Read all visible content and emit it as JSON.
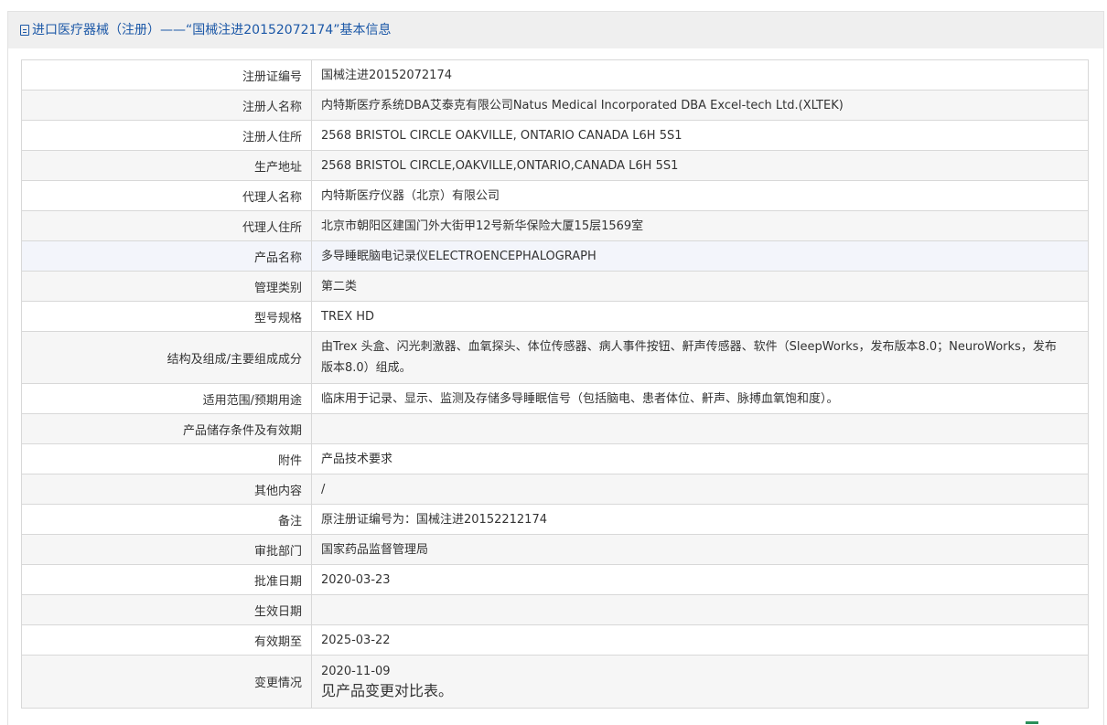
{
  "header": {
    "title": "进口医疗器械（注册）——“国械注进20152072174”基本信息",
    "icon": "document-icon"
  },
  "rows": [
    {
      "label": "注册证编号",
      "value": "国械注进20152072174"
    },
    {
      "label": "注册人名称",
      "value": "内特斯医疗系统DBA艾泰克有限公司Natus Medical Incorporated DBA Excel-tech Ltd.(XLTEK)"
    },
    {
      "label": "注册人住所",
      "value": "2568 BRISTOL CIRCLE OAKVILLE, ONTARIO CANADA L6H 5S1"
    },
    {
      "label": "生产地址",
      "value": "2568 BRISTOL CIRCLE,OAKVILLE,ONTARIO,CANADA L6H 5S1"
    },
    {
      "label": "代理人名称",
      "value": "内特斯医疗仪器（北京）有限公司"
    },
    {
      "label": "代理人住所",
      "value": "北京市朝阳区建国门外大街甲12号新华保险大厦15层1569室"
    },
    {
      "label": "产品名称",
      "value": "多导睡眠脑电记录仪ELECTROENCEPHALOGRAPH"
    },
    {
      "label": "管理类别",
      "value": "第二类"
    },
    {
      "label": "型号规格",
      "value": "TREX HD"
    },
    {
      "label": "结构及组成/主要组成成分",
      "value": "由Trex 头盒、闪光刺激器、血氧探头、体位传感器、病人事件按钮、鼾声传感器、软件（SleepWorks，发布版本8.0；NeuroWorks，发布版本8.0）组成。"
    },
    {
      "label": "适用范围/预期用途",
      "value": "临床用于记录、显示、监测及存储多导睡眠信号（包括脑电、患者体位、鼾声、脉搏血氧饱和度）。"
    },
    {
      "label": "产品储存条件及有效期",
      "value": ""
    },
    {
      "label": "附件",
      "value": "产品技术要求"
    },
    {
      "label": "其他内容",
      "value": "/"
    },
    {
      "label": "备注",
      "value": "原注册证编号为：国械注进20152212174"
    },
    {
      "label": "审批部门",
      "value": "国家药品监督管理局"
    },
    {
      "label": "批准日期",
      "value": "2020-03-23"
    },
    {
      "label": "生效日期",
      "value": ""
    },
    {
      "label": "有效期至",
      "value": "2025-03-22"
    },
    {
      "label": "变更情况",
      "value": "2020-11-09",
      "note": "见产品变更对比表。"
    }
  ]
}
